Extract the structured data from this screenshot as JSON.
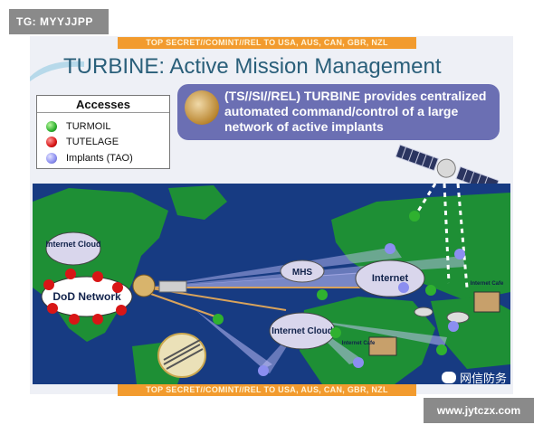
{
  "overlay": {
    "top_tag": "TG: MYYJJPP",
    "bottom_url": "www.jytczx.com",
    "watermark": "网信防务"
  },
  "slide": {
    "classification_banner": "TOP SECRET//COMINT//REL TO USA, AUS, CAN, GBR, NZL",
    "title": "TURBINE: Active Mission Management",
    "legend": {
      "title": "Accesses",
      "items": [
        {
          "label": "TURMOIL",
          "color": "#2fb12f"
        },
        {
          "label": "TUTELAGE",
          "color": "#d81616"
        },
        {
          "label": "Implants (TAO)",
          "color": "#8b8ef0"
        }
      ]
    },
    "callout": {
      "text": "(TS//SI//REL) TURBINE provides centralized automated command/control of a large network of active implants"
    },
    "map": {
      "labels": {
        "internet_cloud_left": "Internet Cloud",
        "dod_network": "DoD Network",
        "mhs": "MHS",
        "internet_right": "Internet",
        "internet_cloud_center": "Internet Cloud",
        "internet_cafe_right": "Internet Cafe",
        "internet_cafe_center": "Internet Cafe"
      },
      "colors": {
        "ocean": "#173b82",
        "land": "#1e8f35",
        "beam": "#c9c6ff",
        "link": "#d9a35b"
      }
    }
  }
}
